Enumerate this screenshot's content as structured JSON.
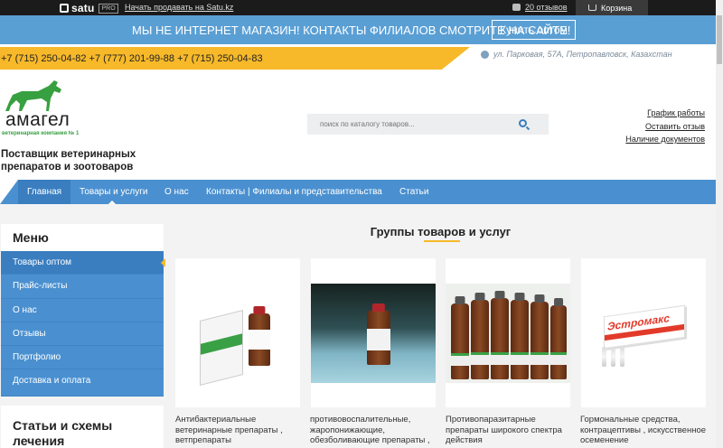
{
  "topbar": {
    "logo": "satu",
    "badge": "PRO",
    "sell_link": "Начать продавать на Satu.kz",
    "reviews": "20 отзывов",
    "cart": "Корзина"
  },
  "banner": {
    "message": "МЫ НЕ ИНТЕРНЕТ МАГАЗИН! КОНТАКТЫ ФИЛИАЛОВ СМОТРИТЕ НА САЙТЕ!",
    "wholesale_button": "Купить оптом"
  },
  "contacts": {
    "phones": "+7 (715) 250-04-82 +7 (777) 201-99-88 +7 (715) 250-04-83",
    "address": "ул. Парковая, 57А, Петропавловск, Казахстан"
  },
  "brand": {
    "name": "амагел",
    "subtitle": "ветеринарная компания № 1",
    "tagline": "Поставщик ветеринарных препаратов и зоотоваров"
  },
  "search": {
    "placeholder": "поиск по каталогу товаров..."
  },
  "quick_links": [
    "График работы",
    "Оставить отзыв",
    "Наличие документов"
  ],
  "nav": [
    "Главная",
    "Товары и услуги",
    "О нас",
    "Контакты | Филиалы и представительства",
    "Статьи"
  ],
  "sidebar": {
    "title": "Меню",
    "items": [
      "Товары оптом",
      "Прайс-листы",
      "О нас",
      "Отзывы",
      "Портфолио",
      "Доставка и оплата"
    ],
    "articles_title": "Статьи и схемы лечения"
  },
  "main": {
    "section_title": "Группы товаров и услуг",
    "cards": [
      "Антибактериальные ветеринарные препараты , ветпрепараты",
      "противовоспалительные, жаропонижающие, обезболивающие препараты ,",
      "Противопаразитарные препараты широкого спектра действия",
      "Гормональные средства, контрацептивы , искусственное осеменение"
    ],
    "card4_brand": "Эстромакс"
  },
  "colors": {
    "nav_blue": "#4a90d0",
    "banner_blue": "#5a9fd4",
    "accent_yellow": "#f7b92a",
    "brand_green": "#37a040"
  }
}
